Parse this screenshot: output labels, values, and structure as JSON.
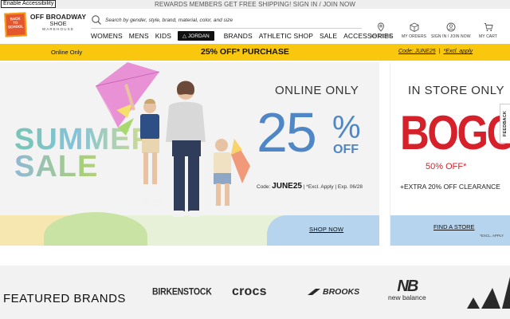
{
  "accessibility": {
    "skip_label": "Enable Accessibility"
  },
  "promo_top": {
    "text": "REWARDS MEMBERS GET FREE SHIPPING! SIGN IN / JOIN NOW"
  },
  "logo": {
    "badge": "BACK TO SCHOOL",
    "line1": "OFF BROADWAY",
    "line2": "SHOE",
    "line3": "WAREHOUSE"
  },
  "search": {
    "placeholder": "Search by gender, style, brand, material, color, and size"
  },
  "nav": {
    "items": [
      "WOMENS",
      "MENS",
      "KIDS"
    ],
    "jordan": "JORDAN",
    "items2": [
      "BRANDS",
      "ATHLETIC SHOP",
      "SALE",
      "ACCESSORIES"
    ]
  },
  "utility": {
    "store": "MY STORE",
    "orders": "MY ORDERS",
    "signin": "SIGN IN / JOIN NOW",
    "cart": "MY CART"
  },
  "offer_bar": {
    "left": "Online Only",
    "center": "25% OFF* PURCHASE",
    "code": "Code: JUNE25",
    "separator": "|",
    "excl": "*Excl. apply"
  },
  "hero": {
    "summer": "SUMMER",
    "sale": "SALE",
    "online_only": "ONLINE ONLY",
    "pct_number": "25",
    "pct_sign": "%",
    "off": "OFF",
    "code_prefix": "Code:",
    "code": "JUNE25",
    "code_suffix": "| *Excl. Apply | Exp. 06/28",
    "shop_now": "SHOP NOW"
  },
  "side_promo": {
    "in_store": "IN STORE ONLY",
    "bogo": "BOGO",
    "fifty_off": "50% OFF*",
    "extra": "+EXTRA 20% OFF CLEARANCE",
    "find_store": "FIND A STORE",
    "excl": "*EXCL. APPLY"
  },
  "feedback": {
    "label": "FEEDBACK"
  },
  "featured": {
    "title": "FEATURED BRANDS",
    "brands": {
      "birkenstock": "BIRKENSTOCK",
      "crocs": "crocs",
      "brooks": "BROOKS",
      "new_balance": "new balance",
      "nb_mark": "NB",
      "adidas": "adidas"
    }
  },
  "colors": {
    "offer_yellow": "#f9c80e",
    "hero_blue": "#4f86c6",
    "bogo_red": "#d6202a"
  }
}
